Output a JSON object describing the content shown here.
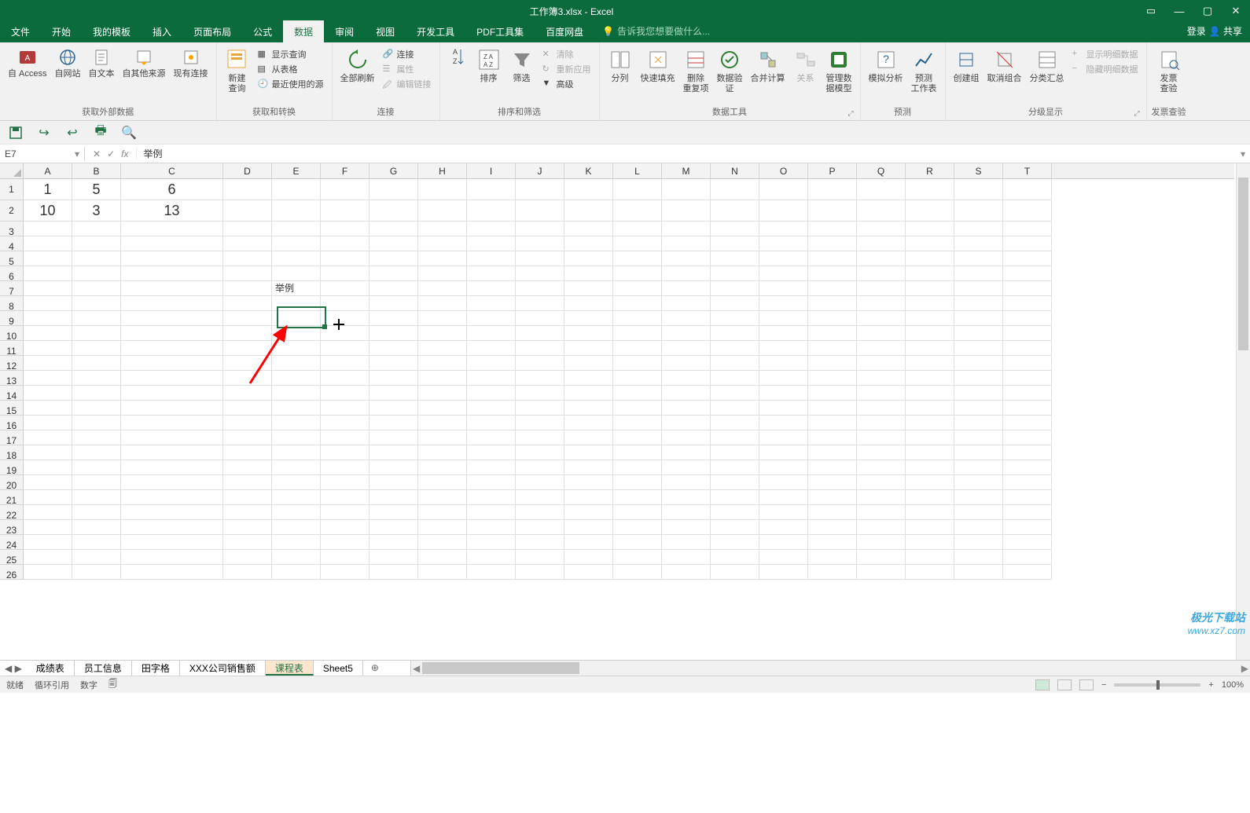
{
  "title": "工作簿3.xlsx - Excel",
  "tabs": {
    "file": "文件",
    "home": "开始",
    "templates": "我的模板",
    "insert": "插入",
    "pagelayout": "页面布局",
    "formulas": "公式",
    "data": "数据",
    "review": "审阅",
    "view": "视图",
    "dev": "开发工具",
    "pdf": "PDF工具集",
    "baidu": "百度网盘",
    "tell": "告诉我您想要做什么..."
  },
  "account": {
    "login": "登录",
    "share": "共享"
  },
  "ribbon": {
    "ext": {
      "access": "自 Access",
      "web": "自网站",
      "text": "自文本",
      "other": "自其他来源",
      "existing": "现有连接",
      "group": "获取外部数据"
    },
    "transform": {
      "newquery": "新建\n查询",
      "show": "显示查询",
      "fromtable": "从表格",
      "recent": "最近使用的源",
      "group": "获取和转换"
    },
    "conn": {
      "refresh": "全部刷新",
      "connections": "连接",
      "properties": "属性",
      "editlinks": "编辑链接",
      "group": "连接"
    },
    "sort": {
      "sort": "排序",
      "filter": "筛选",
      "clear": "清除",
      "reapply": "重新应用",
      "advanced": "高级",
      "group": "排序和筛选"
    },
    "tools": {
      "ttc": "分列",
      "flash": "快速填充",
      "dedup": "删除\n重复项",
      "validate": "数据验\n证",
      "consolidate": "合并计算",
      "relations": "关系",
      "model": "管理数\n据模型",
      "group": "数据工具"
    },
    "forecast": {
      "whatif": "模拟分析",
      "forecast": "预测\n工作表",
      "group": "预测"
    },
    "outline": {
      "grp": "创建组",
      "ungrp": "取消组合",
      "subtotal": "分类汇总",
      "showdetail": "显示明细数据",
      "hidedetail": "隐藏明细数据",
      "group": "分级显示"
    },
    "invoice": {
      "btn": "发票\n查验",
      "group": "发票查验"
    }
  },
  "namebox": "E7",
  "formula": "举例",
  "cols": [
    "A",
    "B",
    "C",
    "D",
    "E",
    "F",
    "G",
    "H",
    "I",
    "J",
    "K",
    "L",
    "M",
    "N",
    "O",
    "P",
    "Q",
    "R",
    "S",
    "T"
  ],
  "rows": [
    "1",
    "2",
    "3",
    "4",
    "5",
    "6",
    "7",
    "8",
    "9",
    "10",
    "11",
    "12",
    "13",
    "14",
    "15",
    "16",
    "17",
    "18",
    "19",
    "20",
    "21",
    "22",
    "23",
    "24",
    "25",
    "26"
  ],
  "data": {
    "A1": "1",
    "B1": "5",
    "C1": "6",
    "A2": "10",
    "B2": "3",
    "C2": "13",
    "E7": "举例"
  },
  "sheets": {
    "s1": "成绩表",
    "s2": "员工信息",
    "s3": "田字格",
    "s4": "XXX公司销售额",
    "s5": "课程表",
    "s6": "Sheet5"
  },
  "status": {
    "ready": "就绪",
    "circ": "循环引用",
    "num": "数字",
    "zoom": "100%"
  },
  "wm": {
    "l1": "极光下载站",
    "l2": "www.xz7.com"
  }
}
